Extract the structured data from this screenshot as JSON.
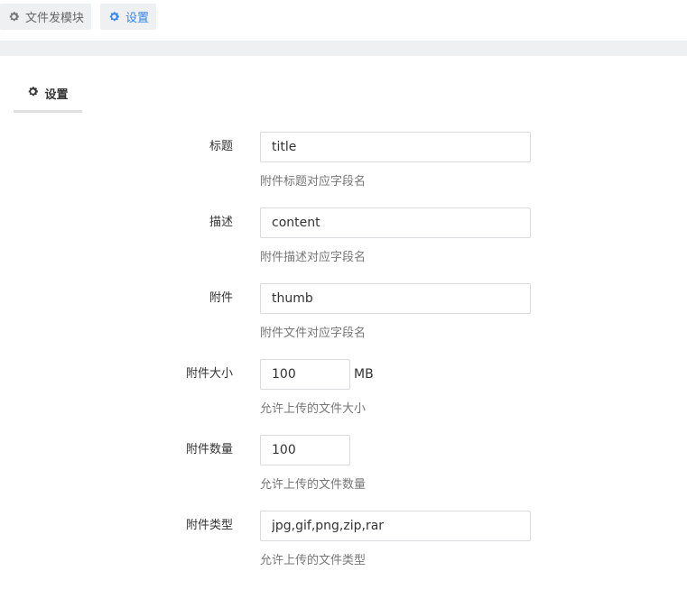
{
  "breadcrumb": {
    "items": [
      {
        "label": "文件发模块",
        "icon": "gear-icon",
        "active": false
      },
      {
        "label": "设置",
        "icon": "gear-icon",
        "active": true
      }
    ]
  },
  "tab": {
    "label": "设置",
    "icon": "gear-icon"
  },
  "form": {
    "title_field": {
      "label": "标题",
      "value": "title",
      "hint": "附件标题对应字段名"
    },
    "desc_field": {
      "label": "描述",
      "value": "content",
      "hint": "附件描述对应字段名"
    },
    "attach_field": {
      "label": "附件",
      "value": "thumb",
      "hint": "附件文件对应字段名"
    },
    "size_field": {
      "label": "附件大小",
      "value": "100",
      "unit": "MB",
      "hint": "允许上传的文件大小"
    },
    "count_field": {
      "label": "附件数量",
      "value": "100",
      "hint": "允许上传的文件数量"
    },
    "type_field": {
      "label": "附件类型",
      "value": "jpg,gif,png,zip,rar",
      "hint": "允许上传的文件类型"
    }
  },
  "colors": {
    "accent": "#3a86e6",
    "band": "#eef0f2"
  }
}
